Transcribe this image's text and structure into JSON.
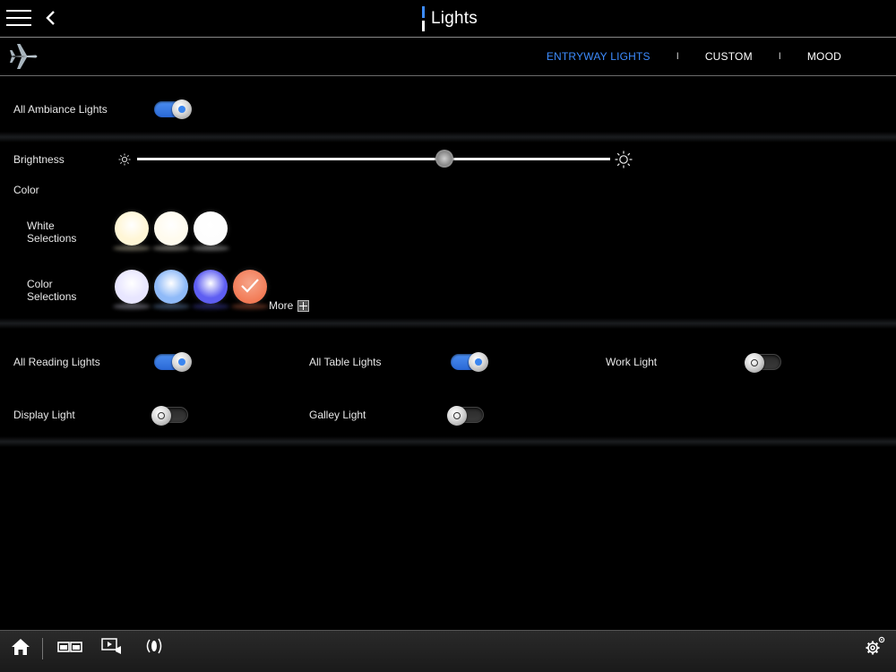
{
  "header": {
    "title": "Lights",
    "menu_icon": "hamburger-menu-icon",
    "back_icon": "chevron-left-icon",
    "accent_color": "#3d8cff"
  },
  "subnav": {
    "logo_icon": "airplane-icon",
    "tabs": [
      {
        "label": "ENTRYWAY LIGHTS",
        "active": true
      },
      {
        "label": "CUSTOM",
        "active": false
      },
      {
        "label": "MOOD",
        "active": false
      }
    ],
    "separator": "I"
  },
  "ambiance": {
    "label": "All Ambiance Lights",
    "on": true
  },
  "brightness": {
    "label": "Brightness",
    "level_percent": 65,
    "low_icon": "sun-small-icon",
    "high_icon": "sun-large-icon"
  },
  "color": {
    "label": "Color",
    "white_label_line1": "White",
    "white_label_line2": "Selections",
    "white_swatches": [
      "#fff6d6",
      "#fffbee",
      "#fdfdfd"
    ],
    "color_label_line1": "Color",
    "color_label_line2": "Selections",
    "color_swatches": [
      "#e8e6ff",
      "#8fbaf8",
      "#5e5ef2",
      "#f27a55"
    ],
    "selected_color_index": 3,
    "more_label": "More"
  },
  "toggles": [
    {
      "label": "All Reading Lights",
      "on": true
    },
    {
      "label": "All Table Lights",
      "on": true
    },
    {
      "label": "Work Light",
      "on": false
    },
    {
      "label": "Display Light",
      "on": false
    },
    {
      "label": "Galley Light",
      "on": false
    }
  ],
  "bottombar": {
    "icons": [
      "home-icon",
      "seats-icon",
      "video-icon",
      "audio-icon",
      "settings-icon"
    ]
  }
}
